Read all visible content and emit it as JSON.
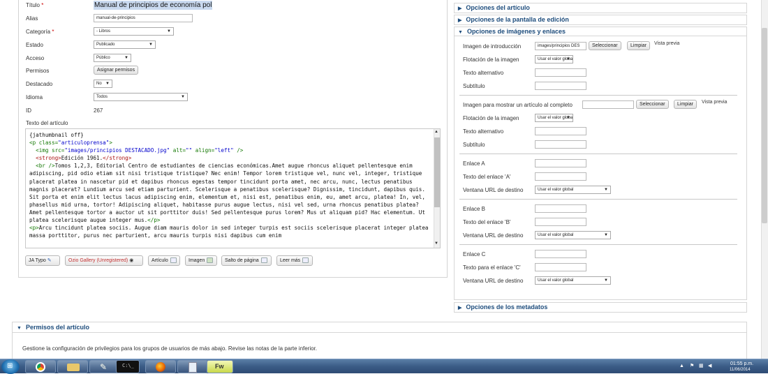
{
  "form": {
    "titulo_label": "Título",
    "titulo_req": "*",
    "titulo_value": "Manual de principios de economía pol",
    "alias_label": "Alias",
    "alias_value": "manual-de-principios",
    "categoria_label": "Categoría",
    "categoria_req": "*",
    "categoria_value": "- Libros",
    "estado_label": "Estado",
    "estado_value": "Publicado",
    "acceso_label": "Acceso",
    "acceso_value": "Público",
    "permisos_label": "Permisos",
    "permisos_button": "Asignar permisos",
    "destacado_label": "Destacado",
    "destacado_value": "No",
    "idioma_label": "Idioma",
    "idioma_value": "Todos",
    "id_label": "ID",
    "id_value": "267",
    "texto_label": "Texto del artículo"
  },
  "editor": {
    "line1": "{jathumbnail off}",
    "line2_tag_open": "<p class=",
    "line2_attr": "\"articuloprensa\"",
    "line2_tag_close": ">",
    "img_tag": "<img src=",
    "img_src": "\"images/principios DESTACADO.jpg\"",
    "img_alt_attr": " alt=",
    "img_alt": "\"\"",
    "img_align_attr": " align=",
    "img_align": "\"left\"",
    "img_close": " />",
    "strong_open": "<strong>",
    "strong_text": "Edición 1961.",
    "strong_close": "</strong>",
    "br_tag": "<br />",
    "paragraph1": "Tomos 1,2,3, Editorial Centro de estudiantes de ciencias económicas.Amet augue rhoncus aliquet pellentesque enim adipiscing, pid odio etiam sit nisi tristique tristique? Nec enim! Tempor lorem tristique vel, nunc vel, integer, tristique placerat platea in nascetur pid et dapibus rhoncus egestas tempor tincidunt porta amet, nec arcu, nunc, lectus penatibus magnis placerat? Lundium arcu sed etiam parturient. Scelerisque a penatibus scelerisque? Dignissim, tincidunt, dapibus quis. Sit porta et enim elit lectus lacus adipiscing enim, elementum et, nisi est, penatibus enim, eu, amet arcu, platea! In, vel, phasellus mid urna, tortor! Adipiscing aliquet, habitasse purus augue lectus, nisi vel sed, urna rhoncus penatibus platea? Amet pellentesque tortor a auctor ut sit porttitor duis! Sed pellentesque purus lorem? Mus ut aliquam pid? Hac elementum. Ut platea scelerisque augue integer mus.",
    "p_close": "</p>",
    "p_open2": "<p>",
    "paragraph2": "Arcu tincidunt platea sociis. Augue diam mauris dolor in sed integer turpis est sociis scelerisque placerat integer platea massa porttitor, purus nec parturient, arcu mauris turpis nisi dapibus cum enim"
  },
  "toolbar": {
    "ja_typo": "JA Typo",
    "ozio": "Ozio Gallery (Unregistered)",
    "articulo": "Artículo",
    "imagen": "Imagen",
    "salto": "Salto de página",
    "leer_mas": "Leer más"
  },
  "right": {
    "opciones_articulo": "Opciones del artículo",
    "opciones_pantalla": "Opciones de la pantalla de edición",
    "opciones_imagenes": "Opciones de imágenes y enlaces",
    "imagen_intro_label": "Imagen de introducción",
    "imagen_intro_value": "images/principios DES",
    "seleccionar": "Seleccionar",
    "limpiar": "Limpiar",
    "vista_previa": "Vista previa",
    "flotacion_label": "Flotación de la imagen",
    "usar_valor_global": "Usar el valor global",
    "texto_alternativo": "Texto alternativo",
    "subtitulo": "Subtítulo",
    "imagen_completo_label": "Imagen para mostrar un artículo al completo",
    "enlace_a": "Enlace A",
    "texto_enlace_a": "Texto del enlace 'A'",
    "ventana_url": "Ventana URL de destino",
    "enlace_b": "Enlace B",
    "texto_enlace_b": "Texto del enlace 'B'",
    "enlace_c": "Enlace C",
    "texto_enlace_c": "Texto para el enlace 'C'",
    "opciones_metadatos": "Opciones de los metadatos"
  },
  "permisos": {
    "title": "Permisos del artículo",
    "description": "Gestione la configuración de privilegios para los grupos de usuarios de más abajo. Revise las notas de la parte inferior."
  },
  "taskbar": {
    "time": "01:55 p.m.",
    "date": "11/06/2014",
    "fw_label": "Fw"
  },
  "colors": {
    "link_blue": "#1d4c7c",
    "required_red": "#cc0000",
    "taskbar": "#3b5c86"
  }
}
